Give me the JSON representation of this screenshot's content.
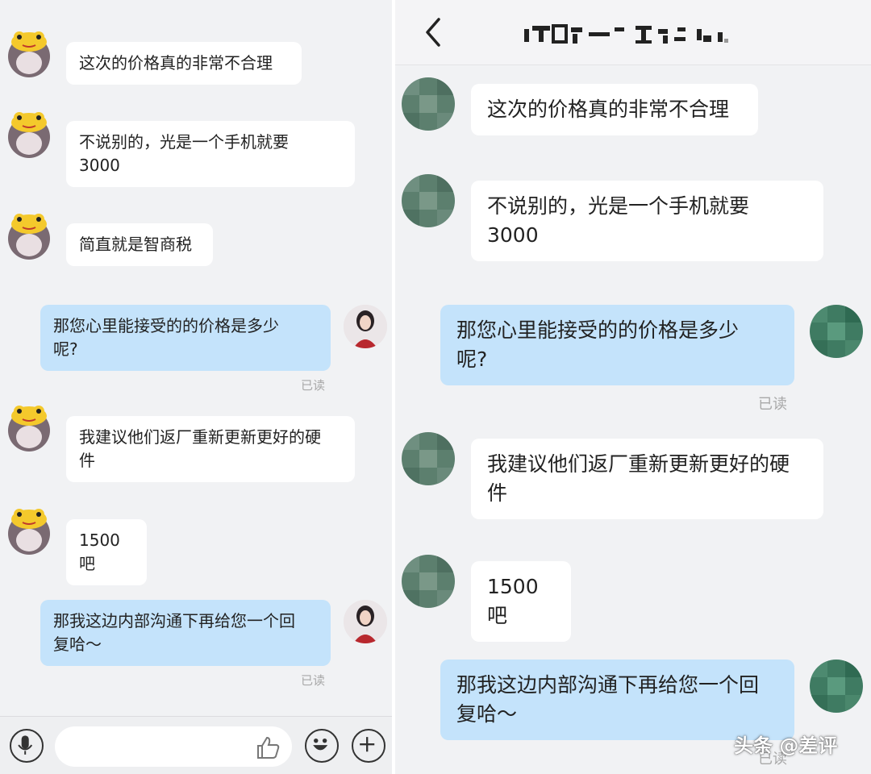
{
  "left": {
    "messages": [
      {
        "side": "in",
        "text": "这次的价格真的非常不合理"
      },
      {
        "side": "in",
        "text": "不说别的，光是一个手机就要\n3000"
      },
      {
        "side": "in",
        "text": "简直就是智商税"
      },
      {
        "side": "out",
        "text": "那您心里能接受的的价格是多少\n呢?",
        "status": "已读"
      },
      {
        "side": "in",
        "text": "我建议他们返厂重新更新更好的硬\n件"
      },
      {
        "side": "in",
        "text": "1500吧"
      },
      {
        "side": "out",
        "text": "那我这边内部沟通下再给您一个回\n复哈～",
        "status": "已读"
      }
    ],
    "input_bar": {
      "placeholder": "",
      "icons": [
        "microphone-icon",
        "thumbs-up-icon",
        "emoji-icon",
        "plus-icon"
      ]
    }
  },
  "right": {
    "header": {
      "back_icon": "chevron-left-icon",
      "title_obscured": true
    },
    "messages": [
      {
        "side": "in",
        "text": "这次的价格真的非常不合理"
      },
      {
        "side": "in",
        "text": "不说别的，光是一个手机就要\n3000"
      },
      {
        "side": "out",
        "text": "那您心里能接受的的价格是多少\n呢?",
        "status": "已读"
      },
      {
        "side": "in",
        "text": "我建议他们返厂重新更新更好的硬\n件"
      },
      {
        "side": "in",
        "text": "1500吧"
      },
      {
        "side": "out",
        "text": "那我这边内部沟通下再给您一个回\n复哈～",
        "status": "已读"
      }
    ]
  },
  "watermark": "头条 @差评",
  "colors": {
    "incoming_bubble": "#ffffff",
    "outgoing_bubble": "#c4e3fb",
    "background": "#f1f2f4",
    "mosaic_green": "#5f8a76"
  }
}
